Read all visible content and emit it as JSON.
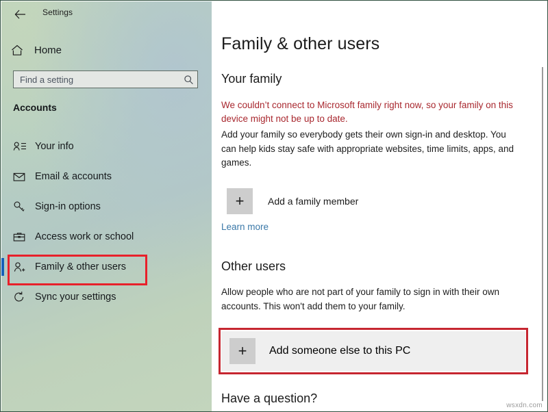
{
  "window": {
    "app_title": "Settings",
    "back_icon": "back-arrow-icon",
    "minimize_label": "─",
    "maximize_label": "□",
    "close_label": "✕"
  },
  "sidebar": {
    "home_label": "Home",
    "home_icon": "home-icon",
    "search": {
      "placeholder": "Find a setting",
      "value": "",
      "icon": "search-icon"
    },
    "section_heading": "Accounts",
    "items": [
      {
        "label": "Your info",
        "icon": "user-info-icon",
        "selected": false
      },
      {
        "label": "Email & accounts",
        "icon": "envelope-icon",
        "selected": false
      },
      {
        "label": "Sign-in options",
        "icon": "key-icon",
        "selected": false
      },
      {
        "label": "Access work or school",
        "icon": "briefcase-icon",
        "selected": false
      },
      {
        "label": "Family & other users",
        "icon": "user-add-icon",
        "selected": true
      },
      {
        "label": "Sync your settings",
        "icon": "sync-icon",
        "selected": false
      }
    ]
  },
  "main": {
    "page_title": "Family & other users",
    "your_family": {
      "heading": "Your family",
      "error_text": "We couldn’t connect to Microsoft family right now, so your family on this device might not be up to date.",
      "description": "Add your family so everybody gets their own sign-in and desktop. You can help kids stay safe with appropriate websites, time limits, apps, and games.",
      "add_member_label": "Add a family member",
      "add_member_icon": "plus-icon",
      "learn_more_label": "Learn more"
    },
    "other_users": {
      "heading": "Other users",
      "description": "Allow people who are not part of your family to sign in with their own accounts. This won't add them to your family.",
      "add_someone_label": "Add someone else to this PC",
      "add_someone_icon": "plus-icon"
    },
    "have_question_heading": "Have a question?"
  },
  "annotations": {
    "highlight_color": "#e8202a",
    "sidebar_highlight_target": "Family & other users",
    "content_highlight_target": "Add someone else to this PC"
  },
  "watermark": "wsxdn.com",
  "colors": {
    "accent_selection": "#1660b8",
    "error_text": "#a8272e",
    "link": "#3a78a8",
    "annotation_red": "#e8202a",
    "tile_gray": "#cdcdcd",
    "row_gray": "#efefef"
  }
}
